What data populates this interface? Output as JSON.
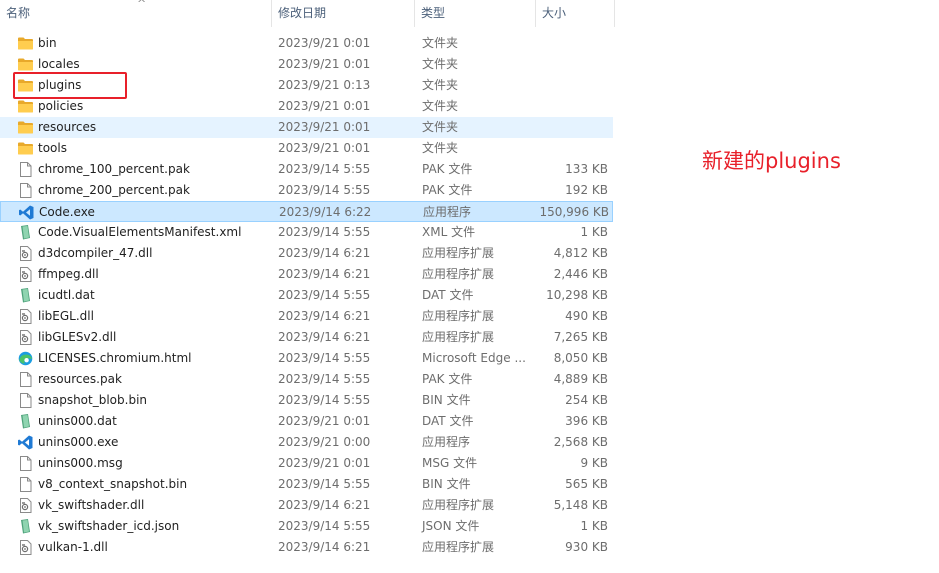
{
  "columns": {
    "name": "名称",
    "date": "修改日期",
    "type": "类型",
    "size": "大小"
  },
  "annotation": "新建的plugins",
  "files": [
    {
      "name": "bin",
      "date": "2023/9/21 0:01",
      "type": "文件夹",
      "size": "",
      "icon": "folder-icon"
    },
    {
      "name": "locales",
      "date": "2023/9/21 0:01",
      "type": "文件夹",
      "size": "",
      "icon": "folder-icon"
    },
    {
      "name": "plugins",
      "date": "2023/9/21 0:13",
      "type": "文件夹",
      "size": "",
      "icon": "folder-icon"
    },
    {
      "name": "policies",
      "date": "2023/9/21 0:01",
      "type": "文件夹",
      "size": "",
      "icon": "folder-icon"
    },
    {
      "name": "resources",
      "date": "2023/9/21 0:01",
      "type": "文件夹",
      "size": "",
      "icon": "folder-icon",
      "state": "hover"
    },
    {
      "name": "tools",
      "date": "2023/9/21 0:01",
      "type": "文件夹",
      "size": "",
      "icon": "folder-icon"
    },
    {
      "name": "chrome_100_percent.pak",
      "date": "2023/9/14 5:55",
      "type": "PAK 文件",
      "size": "133 KB",
      "icon": "file-icon"
    },
    {
      "name": "chrome_200_percent.pak",
      "date": "2023/9/14 5:55",
      "type": "PAK 文件",
      "size": "192 KB",
      "icon": "file-icon"
    },
    {
      "name": "Code.exe",
      "date": "2023/9/14 6:22",
      "type": "应用程序",
      "size": "150,996 KB",
      "icon": "vscode-icon",
      "state": "selected"
    },
    {
      "name": "Code.VisualElementsManifest.xml",
      "date": "2023/9/14 5:55",
      "type": "XML 文件",
      "size": "1 KB",
      "icon": "green-file-icon"
    },
    {
      "name": "d3dcompiler_47.dll",
      "date": "2023/9/14 6:21",
      "type": "应用程序扩展",
      "size": "4,812 KB",
      "icon": "dll-icon"
    },
    {
      "name": "ffmpeg.dll",
      "date": "2023/9/14 6:21",
      "type": "应用程序扩展",
      "size": "2,446 KB",
      "icon": "dll-icon"
    },
    {
      "name": "icudtl.dat",
      "date": "2023/9/14 5:55",
      "type": "DAT 文件",
      "size": "10,298 KB",
      "icon": "green-file-icon"
    },
    {
      "name": "libEGL.dll",
      "date": "2023/9/14 6:21",
      "type": "应用程序扩展",
      "size": "490 KB",
      "icon": "dll-icon"
    },
    {
      "name": "libGLESv2.dll",
      "date": "2023/9/14 6:21",
      "type": "应用程序扩展",
      "size": "7,265 KB",
      "icon": "dll-icon"
    },
    {
      "name": "LICENSES.chromium.html",
      "date": "2023/9/14 5:55",
      "type": "Microsoft Edge ...",
      "size": "8,050 KB",
      "icon": "edge-icon"
    },
    {
      "name": "resources.pak",
      "date": "2023/9/14 5:55",
      "type": "PAK 文件",
      "size": "4,889 KB",
      "icon": "file-icon"
    },
    {
      "name": "snapshot_blob.bin",
      "date": "2023/9/14 5:55",
      "type": "BIN 文件",
      "size": "254 KB",
      "icon": "file-icon"
    },
    {
      "name": "unins000.dat",
      "date": "2023/9/21 0:01",
      "type": "DAT 文件",
      "size": "396 KB",
      "icon": "green-file-icon"
    },
    {
      "name": "unins000.exe",
      "date": "2023/9/21 0:00",
      "type": "应用程序",
      "size": "2,568 KB",
      "icon": "vscode-icon"
    },
    {
      "name": "unins000.msg",
      "date": "2023/9/21 0:01",
      "type": "MSG 文件",
      "size": "9 KB",
      "icon": "file-icon"
    },
    {
      "name": "v8_context_snapshot.bin",
      "date": "2023/9/14 5:55",
      "type": "BIN 文件",
      "size": "565 KB",
      "icon": "file-icon"
    },
    {
      "name": "vk_swiftshader.dll",
      "date": "2023/9/14 6:21",
      "type": "应用程序扩展",
      "size": "5,148 KB",
      "icon": "dll-icon"
    },
    {
      "name": "vk_swiftshader_icd.json",
      "date": "2023/9/14 5:55",
      "type": "JSON 文件",
      "size": "1 KB",
      "icon": "green-file-icon"
    },
    {
      "name": "vulkan-1.dll",
      "date": "2023/9/14 6:21",
      "type": "应用程序扩展",
      "size": "930 KB",
      "icon": "dll-icon"
    }
  ]
}
